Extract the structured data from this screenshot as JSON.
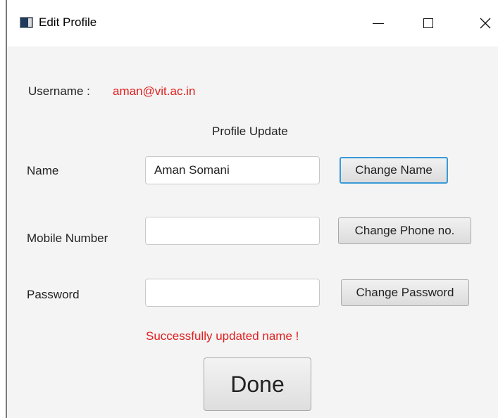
{
  "window": {
    "title": "Edit Profile"
  },
  "header": {
    "username_label": "Username :",
    "username_value": "aman@vit.ac.in",
    "section_title": "Profile Update"
  },
  "form": {
    "name": {
      "label": "Name",
      "value": "Aman Somani",
      "button": "Change Name"
    },
    "mobile": {
      "label": "Mobile Number",
      "value": "",
      "button": "Change Phone no."
    },
    "password": {
      "label": "Password",
      "value": "",
      "button": "Change Password"
    }
  },
  "status": {
    "message": "Successfully updated name !",
    "color": "#e11d1d"
  },
  "actions": {
    "done_label": "Done"
  },
  "colors": {
    "accent": "#3a9ad9",
    "error": "#e11d1d"
  },
  "icons": {
    "app": "app-icon",
    "minimize": "minimize-icon",
    "maximize": "maximize-icon",
    "close": "close-icon"
  }
}
